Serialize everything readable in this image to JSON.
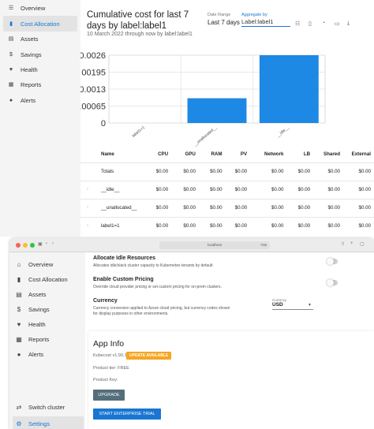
{
  "top_nav": {
    "items": [
      {
        "label": "Overview",
        "icon": "menu-icon"
      },
      {
        "label": "Cost Allocation",
        "icon": "chart-bar-icon",
        "active": true
      },
      {
        "label": "Assets",
        "icon": "list-icon"
      },
      {
        "label": "Savings",
        "icon": "dollar-icon"
      },
      {
        "label": "Health",
        "icon": "heart-icon"
      },
      {
        "label": "Reports",
        "icon": "document-icon"
      },
      {
        "label": "Alerts",
        "icon": "bell-icon"
      }
    ]
  },
  "report": {
    "title": "Cumulative cost for last 7 days by label:label1",
    "subtitle": "10 March 2022 through now by label:label1",
    "date_range_label": "Date Range",
    "date_range_value": "Last 7 days",
    "aggregate_label": "Aggregate by",
    "aggregate_value": "Label:label1"
  },
  "chart_data": {
    "type": "bar",
    "categories": [
      "label1=1",
      "__unallocated__",
      "__idle__"
    ],
    "values": [
      0.0,
      0.00095,
      0.00262
    ],
    "ylim": [
      0,
      0.0026
    ],
    "yticks": [
      0,
      0.00065,
      0.0013,
      0.00195,
      0.0026
    ],
    "ytick_labels": [
      "0",
      ".00065",
      "0.0013",
      "00195",
      "0.0026"
    ],
    "grid": true,
    "bar_color": "#1e88e5"
  },
  "table": {
    "headers": [
      "Name",
      "CPU",
      "GPU",
      "RAM",
      "PV",
      "Network",
      "LB",
      "Shared",
      "External"
    ],
    "rows": [
      [
        "Totals",
        "$0.00",
        "$0.00",
        "$0.00",
        "$0.00",
        "$0.00",
        "$0.00",
        "$0.00",
        "$0.00"
      ],
      [
        "__idle__",
        "$0.00",
        "$0.00",
        "$0.00",
        "$0.00",
        "$0.00",
        "$0.00",
        "$0.00",
        "$0.00"
      ],
      [
        "__unallocated__",
        "$0.00",
        "$0.00",
        "$0.00",
        "$0.00",
        "$0.00",
        "$0.00",
        "$0.00",
        "$0.00"
      ],
      [
        "label1=1",
        "$0.00",
        "$0.00",
        "$0.00",
        "$0.00",
        "$0.00",
        "$0.00",
        "$0.00",
        "$0.00"
      ]
    ]
  },
  "browser": {
    "address": "localhost",
    "address_suffix": "%ts"
  },
  "side_nav": {
    "items": [
      {
        "label": "Overview",
        "icon": "home-icon"
      },
      {
        "label": "Cost Allocation",
        "icon": "bar-chart-icon"
      },
      {
        "label": "Assets",
        "icon": "list-icon"
      },
      {
        "label": "Savings",
        "icon": "dollar-icon"
      },
      {
        "label": "Health",
        "icon": "heart-icon"
      },
      {
        "label": "Reports",
        "icon": "document-icon"
      },
      {
        "label": "Alerts",
        "icon": "bell-icon"
      }
    ],
    "switch_cluster": "Switch cluster",
    "settings": "Settings"
  },
  "settings": {
    "idle_title": "Allocate Idle Resources",
    "idle_desc": "Allocates idle/slack cluster capacity to Kubernetes tenants by default",
    "pricing_title": "Enable Custom Pricing",
    "pricing_desc": "Override cloud provider pricing or set custom pricing for on-prem clusters.",
    "currency_title": "Currency",
    "currency_desc": "Currency conversion applied to Azure cloud pricing, but currency codes shown for display purposes in other environments.",
    "currency_label": "Currency",
    "currency_value": "USD"
  },
  "app_info": {
    "title": "App Info",
    "version": "Kubecost v1.90.1",
    "update_badge": "UPDATE AVAILABLE",
    "product_tier": "Product tier: FREE",
    "product_key": "Product Key:",
    "upgrade_label": "UPGRADE",
    "trial_label": "START ENTERPRISE TRIAL"
  }
}
